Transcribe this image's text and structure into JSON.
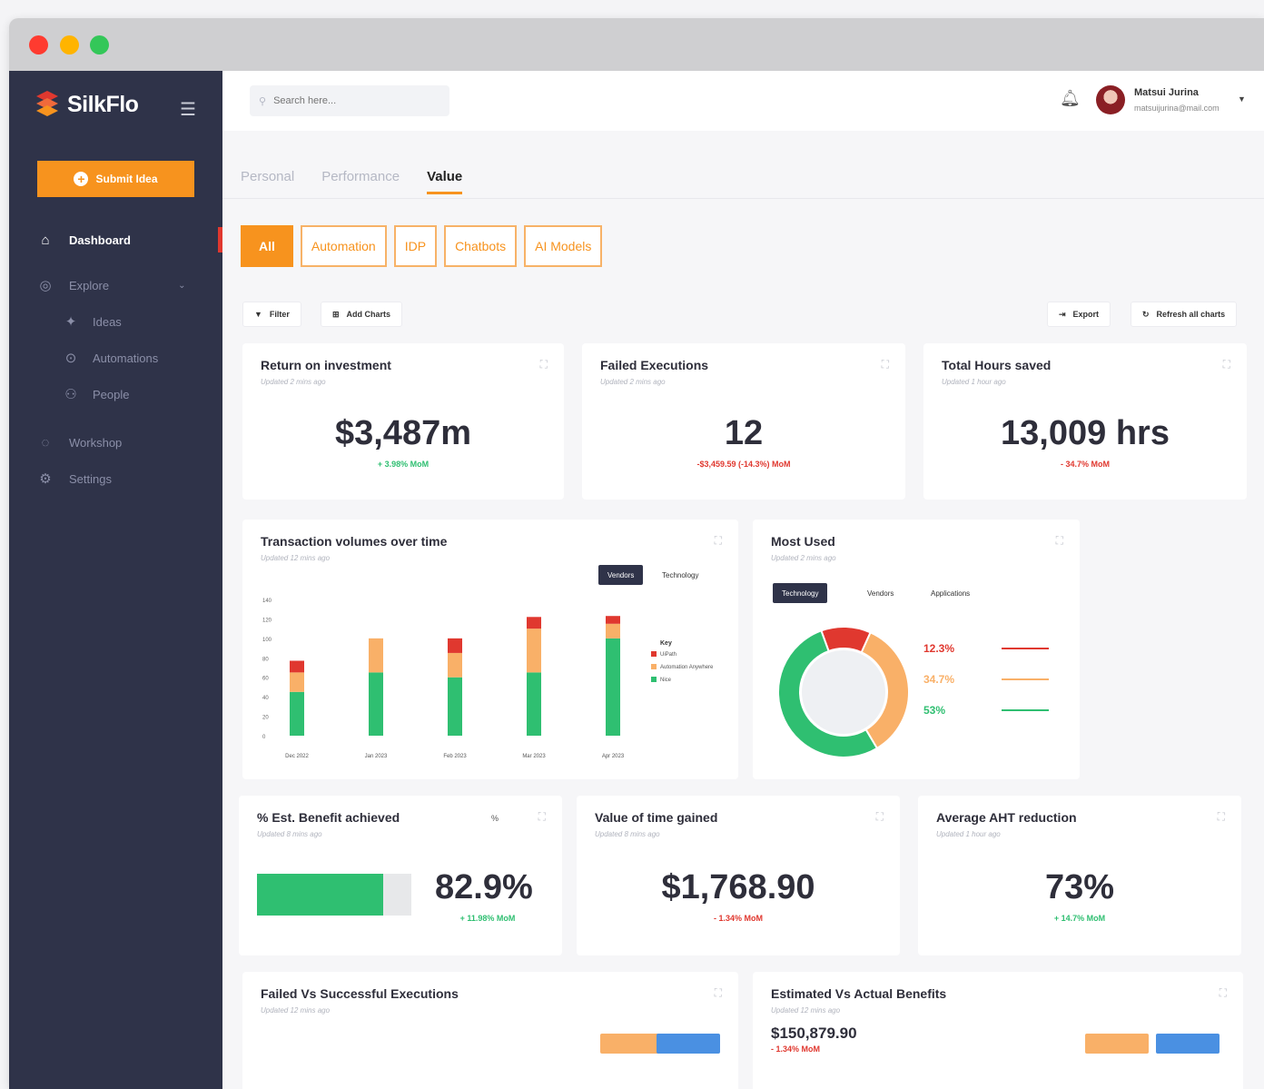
{
  "window": {
    "dots": [
      "#ff3b30",
      "#ffb400",
      "#34c759"
    ]
  },
  "sidebar": {
    "brand": "SilkFlo",
    "submit_label": "Submit Idea",
    "items": [
      {
        "label": "Dashboard",
        "icon": "home-icon"
      },
      {
        "label": "Explore",
        "icon": "compass-icon"
      },
      {
        "label": "Ideas",
        "icon": "lightbulb-icon"
      },
      {
        "label": "Automations",
        "icon": "automation-icon"
      },
      {
        "label": "People",
        "icon": "people-icon"
      },
      {
        "label": "Workshop",
        "icon": "workshop-icon"
      },
      {
        "label": "Settings",
        "icon": "gear-icon"
      }
    ]
  },
  "topbar": {
    "search_placeholder": "Search here...",
    "user_name": "Matsui Jurina",
    "user_email": "matsuijurina@mail.com"
  },
  "tabs": [
    "Personal",
    "Performance",
    "Value"
  ],
  "filters": [
    "All",
    "Automation",
    "IDP",
    "Chatbots",
    "AI Models"
  ],
  "toolbar": {
    "filter": "Filter",
    "add_charts": "Add Charts",
    "export": "Export",
    "refresh": "Refresh all charts"
  },
  "kpis": {
    "roi": {
      "title": "Return on investment",
      "sub": "Updated 2 mins ago",
      "value": "$3,487m",
      "delta": "+ 3.98% MoM"
    },
    "failed": {
      "title": "Failed Executions",
      "sub": "Updated 2 mins ago",
      "value": "12",
      "delta": "-$3,459.59 (-14.3%) MoM"
    },
    "hours": {
      "title": "Total Hours saved",
      "sub": "Updated 1 hour ago",
      "value": "13,009 hrs",
      "delta": "- 34.7% MoM"
    },
    "benefit": {
      "title": "% Est. Benefit achieved",
      "sub": "Updated 8 mins ago",
      "value": "82.9%",
      "delta": "+ 11.98% MoM",
      "progress": 0.82,
      "toggle": "%"
    },
    "time_value": {
      "title": "Value of time gained",
      "sub": "Updated 8 mins ago",
      "value": "$1,768.90",
      "delta": "- 1.34% MoM"
    },
    "aht": {
      "title": "Average AHT reduction",
      "sub": "Updated 1 hour ago",
      "value": "73%",
      "delta": "+ 14.7% MoM"
    }
  },
  "transactions": {
    "title": "Transaction volumes over time",
    "sub": "Updated 12 mins ago",
    "toggle": [
      "Vendors",
      "Technology"
    ],
    "legend_title": "Key",
    "colors": [
      "#2fbf71",
      "#f9b068",
      "#e0382f"
    ]
  },
  "most_used": {
    "title": "Most Used",
    "sub": "Updated 2 mins ago",
    "toggle": [
      "Technology",
      "Vendors",
      "Applications"
    ],
    "slice_labels": [
      "12.3%",
      "34.7%",
      "53%"
    ],
    "colors": [
      "#e0382f",
      "#f9b068",
      "#2fbf71"
    ]
  },
  "bottom": {
    "failed_vs": {
      "title": "Failed Vs Successful Executions",
      "sub": "Updated 12 mins ago"
    },
    "est_vs": {
      "title": "Estimated Vs Actual Benefits",
      "sub": "Updated 12 mins ago",
      "value": "$150,879.90",
      "delta": "- 1.34% MoM"
    }
  },
  "chart_data": [
    {
      "type": "bar",
      "stacked": true,
      "categories": [
        "Dec 2022",
        "Jan 2023",
        "Feb 2023",
        "Mar 2023",
        "Apr 2023"
      ],
      "series": [
        {
          "name": "Nice",
          "values": [
            45,
            65,
            60,
            65,
            100
          ]
        },
        {
          "name": "Automation Anywhere",
          "values": [
            20,
            35,
            25,
            45,
            15
          ]
        },
        {
          "name": "UiPath",
          "values": [
            12,
            0,
            15,
            12,
            8
          ]
        }
      ],
      "ylim": [
        0,
        140
      ],
      "yticks": [
        "0",
        "20",
        "40",
        "60",
        "80",
        "100",
        "120",
        "140"
      ]
    },
    {
      "type": "pie",
      "donut": true,
      "values": [
        12.3,
        34.7,
        53
      ],
      "start_angle": -20
    }
  ]
}
